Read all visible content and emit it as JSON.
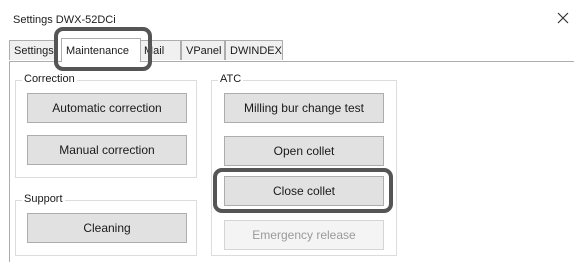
{
  "window": {
    "title": "Settings DWX-52DCi",
    "close_glyph": "✕"
  },
  "tabs": [
    {
      "label": "Settings"
    },
    {
      "label": "Maintenance",
      "active": true
    },
    {
      "label": "Mail"
    },
    {
      "label": "VPanel"
    },
    {
      "label": "DWINDEX"
    }
  ],
  "correction": {
    "label": "Correction",
    "automatic_label": "Automatic correction",
    "manual_label": "Manual correction"
  },
  "support": {
    "label": "Support",
    "cleaning_label": "Cleaning"
  },
  "atc": {
    "label": "ATC",
    "milling_bur_label": "Milling bur change test",
    "open_collet_label": "Open collet",
    "close_collet_label": "Close collet",
    "emergency_release_label": "Emergency release"
  },
  "colors": {
    "highlight": "#555555",
    "button_face": "#e1e1e1",
    "disabled_text": "#9a9a9a"
  }
}
